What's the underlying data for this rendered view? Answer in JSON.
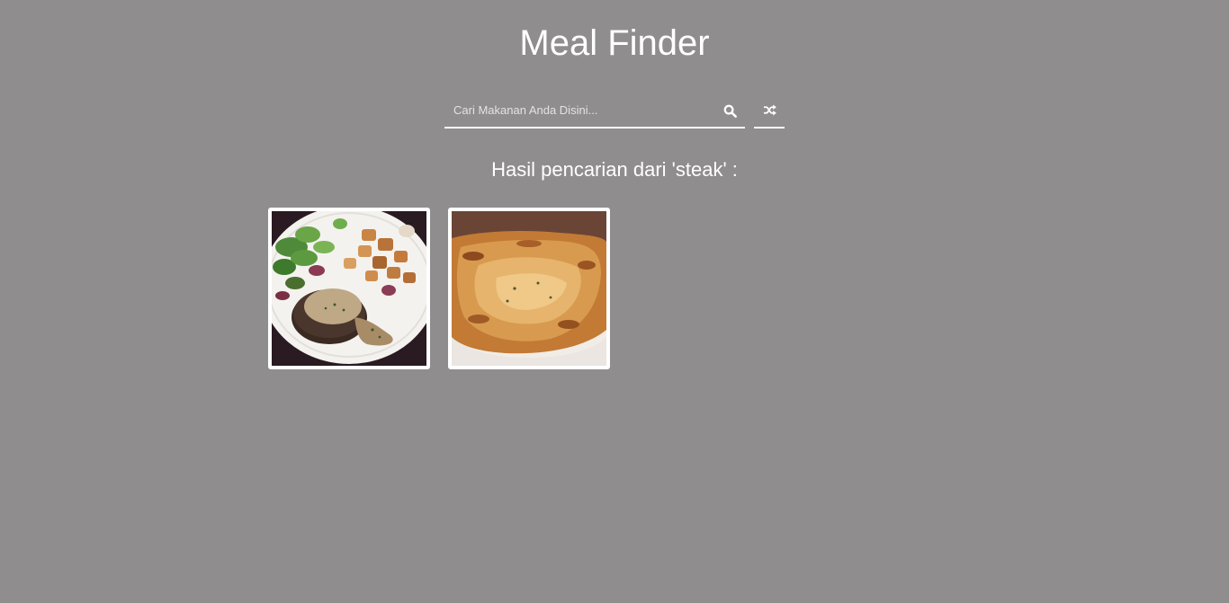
{
  "app": {
    "title": "Meal Finder"
  },
  "search": {
    "placeholder": "Cari Makanan Anda Disini...",
    "value": "",
    "search_icon": "search-icon",
    "random_icon": "shuffle-icon"
  },
  "results": {
    "heading": "Hasil pencarian dari 'steak' :",
    "meals": [
      {
        "image": "steak-with-salad-and-potatoes"
      },
      {
        "image": "steak-pie-with-pastry-crust"
      }
    ]
  },
  "colors": {
    "background": "#8f8d8e",
    "text": "#ffffff",
    "card_border": "#ffffff"
  }
}
